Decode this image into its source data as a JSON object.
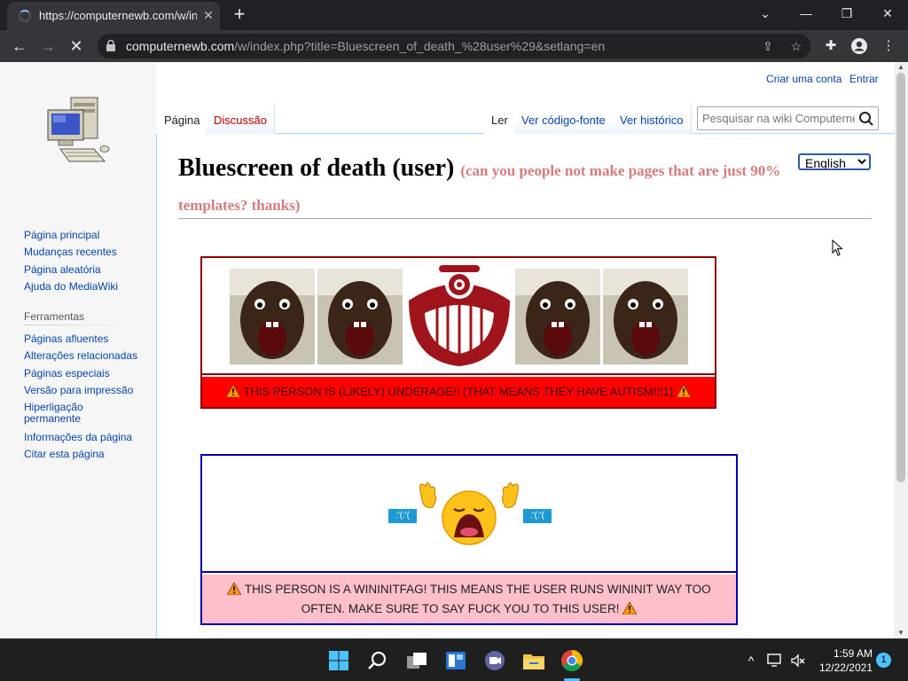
{
  "browser": {
    "tab_title": "https://computernewb.com/w/index.php?title=Bluescreen_of_death_%28user%29&setlang=en",
    "url_host": "computernewb.com",
    "url_path": "/w/index.php?title=Bluescreen_of_death_%28user%29&setlang=en"
  },
  "wiki": {
    "personal": {
      "create_account": "Criar uma conta",
      "login": "Entrar"
    },
    "tabs": {
      "page": "Página",
      "discussion": "Discussão",
      "read": "Ler",
      "view_source": "Ver código-fonte",
      "history": "Ver histórico"
    },
    "search_placeholder": "Pesquisar na wiki Computernewb",
    "navigation": [
      "Página principal",
      "Mudanças recentes",
      "Página aleatória",
      "Ajuda do MediaWiki"
    ],
    "tools_heading": "Ferramentas",
    "tools": [
      "Páginas afluentes",
      "Alterações relacionadas",
      "Páginas especiais",
      "Versão para impressão",
      "Hiperligação permanente",
      "Informações da página",
      "Citar esta página"
    ]
  },
  "page": {
    "title": "Bluescreen of death (user)",
    "subtitle": "(can you people not make pages that are just 90% templates? thanks)",
    "language_selected": "English",
    "userbox1_text": "THIS PERSON IS (LIKELY) UNDERAGE!! (THAT MEANS THEY HAVE AUTISM!!!1)",
    "userbox2_text": "THIS PERSON IS A WININITFAG! THIS MEANS THE USER RUNS WININIT WAY TOO OFTEN. MAKE SURE TO SAY FUCK YOU TO THIS USER!",
    "tear_label": ":'(:'("
  },
  "taskbar": {
    "time": "1:59 AM",
    "date": "12/22/2021",
    "notifications": "1"
  },
  "colors": {
    "link": "#0645ad",
    "redlink": "#ba0000",
    "userbox1_border": "#8b0000",
    "userbox1_band": "#ff0000",
    "userbox2_border": "#0000b0",
    "userbox2_band": "#ffc0cb",
    "chrome_dark": "#202124"
  },
  "icons": [
    "spinner-icon",
    "close-icon",
    "new-tab-icon",
    "back-icon",
    "forward-icon",
    "stop-icon",
    "lock-icon",
    "share-icon",
    "star-icon",
    "extensions-icon",
    "profile-icon",
    "menu-icon",
    "search-icon",
    "warning-icon",
    "computer-logo",
    "windows-start-icon",
    "search-taskbar-icon",
    "task-view-icon",
    "widgets-icon",
    "teams-chat-icon",
    "file-explorer-icon",
    "chrome-icon"
  ]
}
